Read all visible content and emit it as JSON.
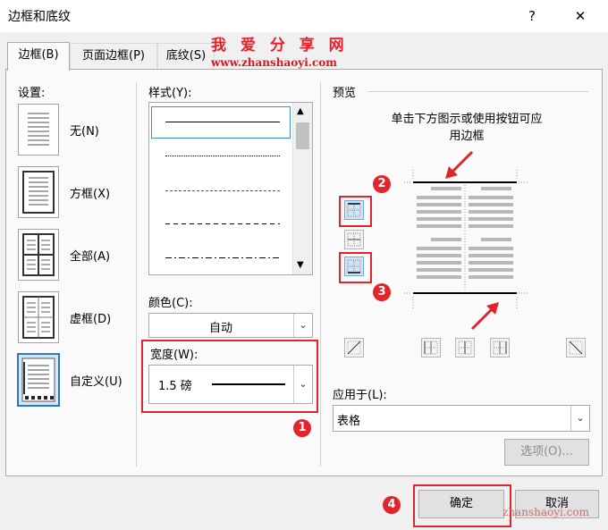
{
  "window": {
    "title": "边框和底纹",
    "help": "?",
    "close": "✕"
  },
  "watermark": {
    "cn": "我 爱 分 享 网",
    "en": "www.zhanshaoyi.com",
    "corner": "zhanshaoyi.com"
  },
  "tabs": [
    {
      "label": "边框(B)",
      "active": true
    },
    {
      "label": "页面边框(P)",
      "active": false
    },
    {
      "label": "底纹(S)",
      "active": false
    }
  ],
  "settings": {
    "heading": "设置:",
    "items": [
      {
        "label": "无(N)"
      },
      {
        "label": "方框(X)"
      },
      {
        "label": "全部(A)"
      },
      {
        "label": "虚框(D)"
      },
      {
        "label": "自定义(U)",
        "selected": true
      }
    ]
  },
  "style": {
    "heading": "样式(Y):",
    "lines": [
      "solid",
      "dotted",
      "dashed-small",
      "dashed",
      "dash-dot"
    ]
  },
  "color": {
    "heading": "颜色(C):",
    "value": "自动"
  },
  "width": {
    "heading": "宽度(W):",
    "value": "1.5 磅"
  },
  "preview": {
    "heading": "预览",
    "hint_line1": "单击下方图示或使用按钮可应",
    "hint_line2": "用边框"
  },
  "apply": {
    "heading": "应用于(L):",
    "value": "表格"
  },
  "options_button": "选项(O)...",
  "ok_button": "确定",
  "cancel_button": "取消",
  "badges": [
    "1",
    "2",
    "3",
    "4"
  ],
  "colors": {
    "accent": "#2b76c9",
    "highlight": "#e3242b"
  }
}
